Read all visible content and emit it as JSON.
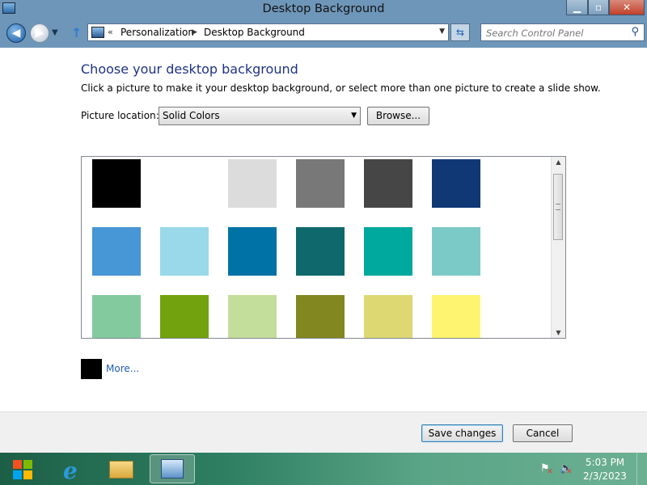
{
  "window": {
    "title": "Desktop Background",
    "minimize_glyph": "▁",
    "maximize_glyph": "▫",
    "close_glyph": "✕"
  },
  "navbar": {
    "back_glyph": "◀",
    "forward_glyph": "▶",
    "history_glyph": "▼",
    "up_glyph": "↑",
    "breadcrumb_chevron_start": "«",
    "breadcrumbs": [
      "Personalization",
      "Desktop Background"
    ],
    "breadcrumb_sep": "▶",
    "address_dropdown_glyph": "▼",
    "refresh_glyph": "⇆",
    "search_placeholder": "Search Control Panel",
    "search_glyph": "⚲"
  },
  "main": {
    "heading": "Choose your desktop background",
    "instruction": "Click a picture to make it your desktop background, or select more than one picture to create a slide show.",
    "picture_location_label": "Picture location:",
    "picture_location_value": "Solid Colors",
    "dropdown_glyph": "▼",
    "browse_label": "Browse...",
    "swatches": [
      [
        "#000000",
        "#ffffff",
        "#dcdcdc",
        "#787878",
        "#464646",
        "#0f3875"
      ],
      [
        "#4796d5",
        "#99d9ea",
        "#0072a5",
        "#0f686c",
        "#00a99d",
        "#7ccac8"
      ],
      [
        "#83cb9f",
        "#72a20d",
        "#c3dd9b",
        "#82871f",
        "#ddd872",
        "#fff470"
      ]
    ],
    "scroll_up_glyph": "▲",
    "scroll_down_glyph": "▼",
    "more_color": "#000000",
    "more_label": "More..."
  },
  "footer": {
    "save_label": "Save changes",
    "cancel_label": "Cancel"
  },
  "taskbar": {
    "ie_glyph": "e",
    "tray_flag_glyph": "⚑",
    "tray_volume_glyph": "🔈",
    "tray_x_glyph": "✕",
    "time": "5:03 PM",
    "date": "2/3/2023"
  },
  "colors": {
    "titlebar": "#6e96b9",
    "heading": "#1e3287",
    "link": "#1e5cb3",
    "taskbar_start": "#1c5f46",
    "taskbar_end": "#6cb092"
  }
}
